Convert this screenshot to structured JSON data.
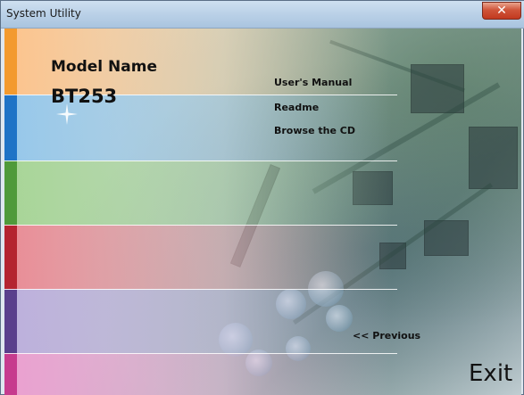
{
  "window": {
    "title": "System Utility",
    "close_icon": "close-icon"
  },
  "model": {
    "label": "Model Name",
    "value": "BT253"
  },
  "links": [
    {
      "label": "User's Manual"
    },
    {
      "label": "Readme"
    },
    {
      "label": "Browse the CD"
    }
  ],
  "nav": {
    "previous_label": "<< Previous",
    "exit_label": "Exit"
  },
  "colors": {
    "stripe_orange": "#f39a2e",
    "stripe_blue": "#1f73c6",
    "stripe_green": "#4f9a3a",
    "stripe_red": "#b42430",
    "stripe_purple": "#5a3f8c",
    "stripe_pink": "#c63b8e"
  }
}
